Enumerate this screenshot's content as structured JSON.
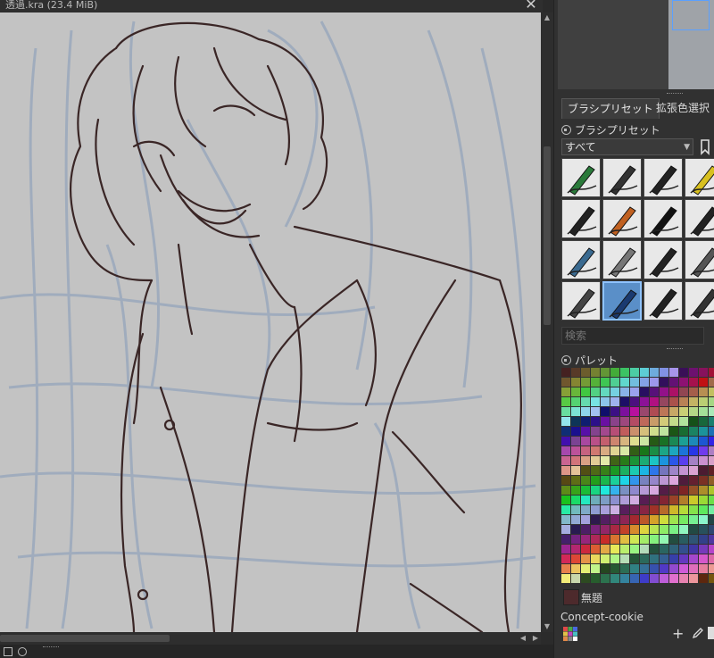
{
  "window": {
    "title": "透過.kra (23.4 MiB)",
    "close_glyph": "✕"
  },
  "dock": {
    "tabs": [
      {
        "label": "ブラシプリセット",
        "active": true
      },
      {
        "label": "拡張色選択",
        "active": false
      }
    ],
    "brush_presets": {
      "header": "ブラシプリセット",
      "filter_value": "すべて",
      "search_placeholder": "検索",
      "items": [
        "pencil",
        "ink-pen",
        "marker-pen",
        "yellow-pencil",
        "fountain-pen",
        "paint-brush",
        "dark-brush",
        "round-brush",
        "blue-marker",
        "gray-marker",
        "black-marker",
        "soft-brush",
        "blender",
        "blue-pen-selected",
        "bristle-brush",
        "fan-brush"
      ],
      "selected_index": 13
    },
    "palette": {
      "header": "パレット",
      "current_color_name": "無題",
      "current_color": "#4d2a2c",
      "palette_name": "Concept-cookie"
    }
  },
  "colors": {
    "canvas_bg": "#c3c3c3",
    "accent": "#5aa0ff",
    "line_dark": "#3a2626",
    "sketch_blue": "#9aa9bc"
  }
}
